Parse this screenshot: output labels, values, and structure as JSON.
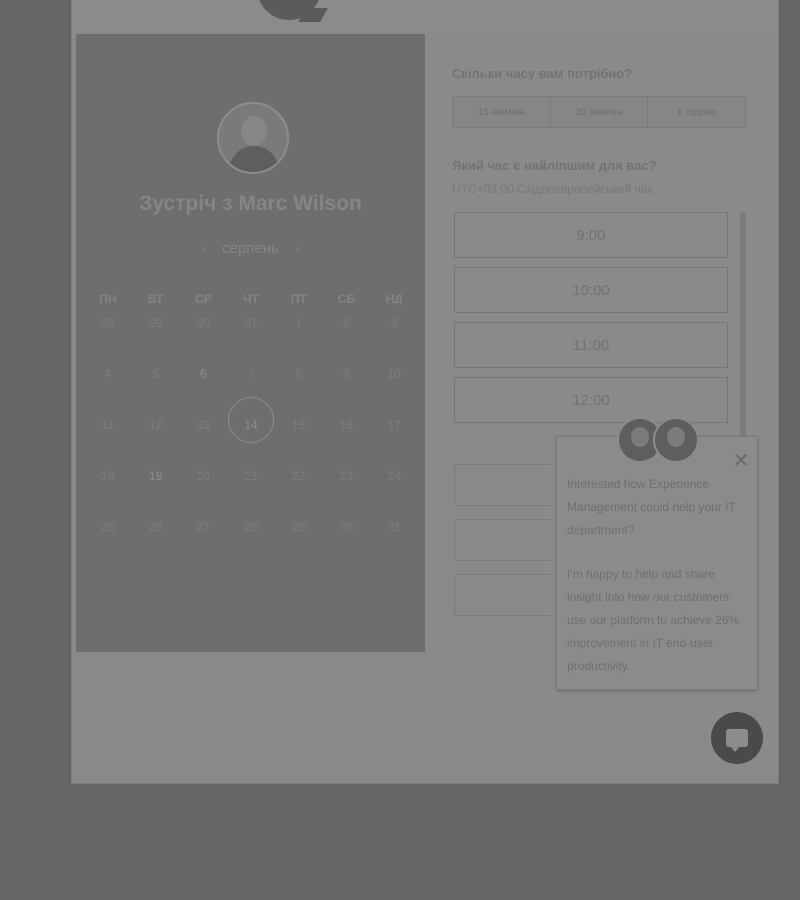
{
  "left_panel": {
    "meeting_title": "Зустріч з Marc Wilson",
    "month_label": "серпень",
    "weekdays": [
      "ПН",
      "ВТ",
      "СР",
      "ЧТ",
      "ПТ",
      "СБ",
      "НД"
    ],
    "weeks": [
      [
        "28",
        "29",
        "30",
        "31",
        "1",
        "2",
        "3"
      ],
      [
        "4",
        "5",
        "6",
        "7",
        "8",
        "9",
        "10"
      ],
      [
        "11",
        "12",
        "13",
        "14",
        "15",
        "16",
        "17"
      ],
      [
        "18",
        "19",
        "20",
        "21",
        "22",
        "23",
        "24"
      ],
      [
        "25",
        "26",
        "27",
        "28",
        "29",
        "30",
        "31"
      ]
    ]
  },
  "right_panel": {
    "duration_question": "Скільки часу вам потрібно?",
    "durations": [
      "15 хвилин",
      "30 хвилин",
      "1 година"
    ],
    "time_question": "Який час є найліпшим для вас?",
    "timezone": "UTC+03:00 Східноєвропейський час",
    "slots": [
      "9:00",
      "10:00",
      "11:00",
      "12:00"
    ]
  },
  "chat": {
    "message_1": "Interested how Experience Management could help your IT department?",
    "message_2": "I'm happy to help and share insight into how our customers use our platform to achieve 26% improvement in IT end-user productivity."
  }
}
